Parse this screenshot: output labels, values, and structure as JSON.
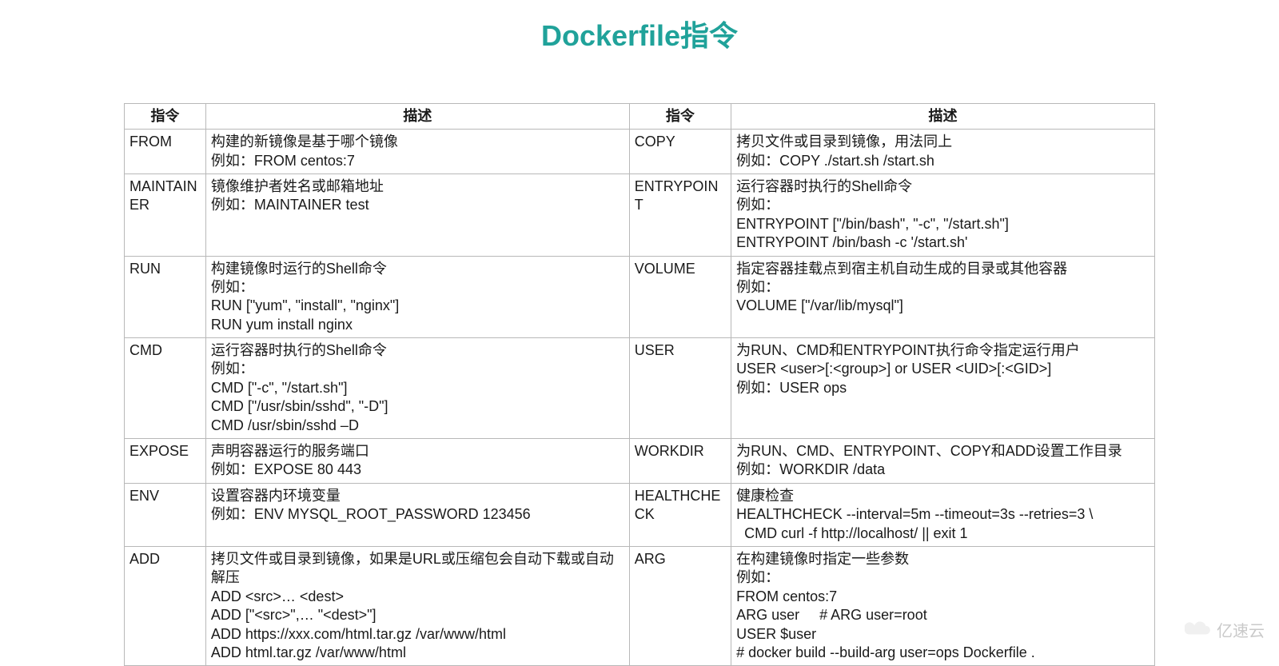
{
  "title": "Dockerfile指令",
  "headers": {
    "cmd": "指令",
    "desc": "描述"
  },
  "rows": [
    {
      "l_cmd": "FROM",
      "l_desc": [
        "构建的新镜像是基于哪个镜像",
        "例如：FROM centos:7"
      ],
      "r_cmd": "COPY",
      "r_desc": [
        "拷贝文件或目录到镜像，用法同上",
        "例如：COPY ./start.sh /start.sh"
      ]
    },
    {
      "l_cmd": "MAINTAINER",
      "l_desc": [
        "镜像维护者姓名或邮箱地址",
        "例如：MAINTAINER test"
      ],
      "r_cmd": "ENTRYPOINT",
      "r_desc": [
        "运行容器时执行的Shell命令",
        "例如：",
        "ENTRYPOINT [\"/bin/bash\", \"-c\", \"/start.sh\"]",
        "ENTRYPOINT /bin/bash -c '/start.sh'"
      ]
    },
    {
      "l_cmd": "RUN",
      "l_desc": [
        "构建镜像时运行的Shell命令",
        "例如：",
        "RUN [\"yum\", \"install\", \"nginx\"]",
        "RUN yum install nginx"
      ],
      "r_cmd": "VOLUME",
      "r_desc": [
        "指定容器挂载点到宿主机自动生成的目录或其他容器",
        "例如：",
        "VOLUME [\"/var/lib/mysql\"]"
      ]
    },
    {
      "l_cmd": "CMD",
      "l_desc": [
        "运行容器时执行的Shell命令",
        "例如：",
        "CMD [\"-c\", \"/start.sh\"]",
        "CMD [\"/usr/sbin/sshd\", \"-D\"]",
        "CMD /usr/sbin/sshd –D"
      ],
      "r_cmd": "USER",
      "r_desc": [
        "为RUN、CMD和ENTRYPOINT执行命令指定运行用户",
        "USER <user>[:<group>] or USER <UID>[:<GID>]",
        "例如：USER ops"
      ]
    },
    {
      "l_cmd": "EXPOSE",
      "l_desc": [
        "声明容器运行的服务端口",
        "例如：EXPOSE 80 443"
      ],
      "r_cmd": "WORKDIR",
      "r_desc": [
        "为RUN、CMD、ENTRYPOINT、COPY和ADD设置工作目录",
        "例如：WORKDIR /data"
      ]
    },
    {
      "l_cmd": "ENV",
      "l_desc": [
        "设置容器内环境变量",
        "例如：ENV MYSQL_ROOT_PASSWORD 123456"
      ],
      "r_cmd": "HEALTHCHECK",
      "r_desc": [
        "健康检查",
        "HEALTHCHECK --interval=5m --timeout=3s --retries=3 \\",
        "  CMD curl -f http://localhost/ || exit 1"
      ]
    },
    {
      "l_cmd": "ADD",
      "l_desc": [
        "拷贝文件或目录到镜像，如果是URL或压缩包会自动下载或自动解压",
        "ADD <src>… <dest>",
        "ADD [\"<src>\",… \"<dest>\"]",
        "ADD https://xxx.com/html.tar.gz /var/www/html",
        "ADD html.tar.gz /var/www/html"
      ],
      "r_cmd": "ARG",
      "r_desc": [
        "在构建镜像时指定一些参数",
        "例如：",
        "FROM centos:7",
        "ARG user     # ARG user=root",
        "USER $user",
        "# docker build --build-arg user=ops Dockerfile ."
      ]
    }
  ],
  "watermark": "亿速云"
}
